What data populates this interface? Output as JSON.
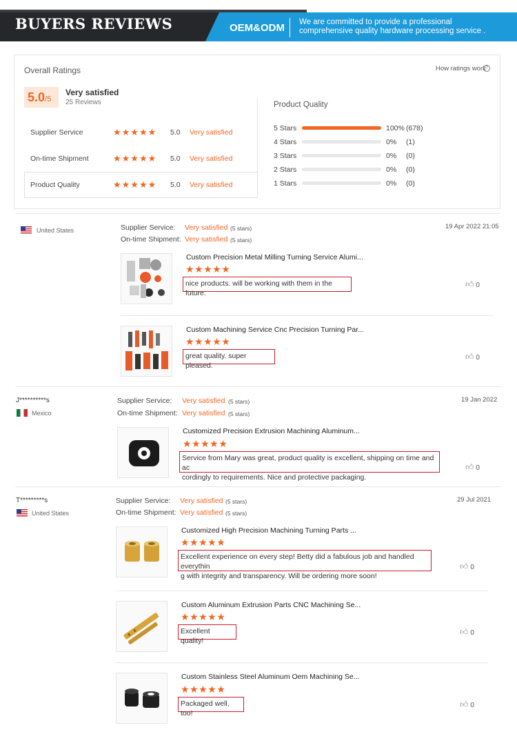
{
  "banner": {
    "title": "BUYERS REVIEWS",
    "tag": "OEM&ODM",
    "description": "We are committed to provide a professional comprehensive quality hardware processing service ."
  },
  "overall": {
    "title": "Overall Ratings",
    "how_link": "How ratings work",
    "score": "5.0",
    "score_max": "/5",
    "satisfaction": "Very satisfied",
    "review_count": "25 Reviews",
    "categories": [
      {
        "label": "Supplier Service",
        "stars": "★★★★★",
        "score": "5.0",
        "text": "Very satisfied"
      },
      {
        "label": "On-time Shipment",
        "stars": "★★★★★",
        "score": "5.0",
        "text": "Very satisfied"
      },
      {
        "label": "Product Quality",
        "stars": "★★★★★",
        "score": "5.0",
        "text": "Very satisfied"
      }
    ],
    "product_quality": {
      "title": "Product Quality",
      "rows": [
        {
          "label": "5 Stars",
          "percent": "100%",
          "count": "(678)",
          "fill": 1.0
        },
        {
          "label": "4 Stars",
          "percent": "0%",
          "count": "(1)",
          "fill": 0
        },
        {
          "label": "3 Stars",
          "percent": "0%",
          "count": "(0)",
          "fill": 0
        },
        {
          "label": "2 Stars",
          "percent": "0%",
          "count": "(0)",
          "fill": 0
        },
        {
          "label": "1 Stars",
          "percent": "0%",
          "count": "(0)",
          "fill": 0
        }
      ]
    }
  },
  "reviews": [
    {
      "name": "",
      "country": "United States",
      "supplier_label": "Supplier Service:",
      "supplier_value": "Very satisfied",
      "supplier_stars": "(5 stars)",
      "shipment_label": "On-time Shipment:",
      "shipment_value": "Very satisfied",
      "shipment_stars": "(5 stars)",
      "date": "19 Apr 2022 21:05",
      "items": [
        {
          "title": "Custom Precision Metal Milling Turning Service Alumi...",
          "stars": "★★★★★",
          "comment": "nice products. will be working with them in the future.",
          "likes": "0"
        },
        {
          "title": "Custom Machining Service Cnc Precision Turning Par...",
          "stars": "★★★★★",
          "comment": "great quality. super pleased.",
          "likes": "0"
        }
      ]
    },
    {
      "name": "J**********s",
      "country": "Mexico",
      "supplier_label": "Supplier Service:",
      "supplier_value": "Very satisfied",
      "supplier_stars": "(5 stars)",
      "shipment_label": "On-time Shipment:",
      "shipment_value": "Very satisfied",
      "shipment_stars": "(5 stars)",
      "date": "19 Jan 2022",
      "items": [
        {
          "title": "Customized Precision Extrusion Machining Aluminum...",
          "stars": "★★★★★",
          "comment_line1": "Service from Mary was great, product quality is excellent, shipping on time and ac",
          "comment_line2": "cordingly to requirements. Nice and protective packaging.",
          "likes": "0"
        }
      ]
    },
    {
      "name": "T*********s",
      "country": "United States",
      "supplier_label": "Supplier Service:",
      "supplier_value": "Very satisfied",
      "supplier_stars": "(5 stars)",
      "shipment_label": "On-time Shipment:",
      "shipment_value": "Very satisfied",
      "shipment_stars": "(5 stars)",
      "date": "29 Jul 2021",
      "items": [
        {
          "title": "Customized High Precision Machining Turning Parts ...",
          "stars": "★★★★★",
          "comment_line1": "Excellent experience on every step! Betty did a fabulous job and handled everythin",
          "comment_line2": "g with integrity and transparency. Will be ordering more soon!",
          "likes": "0"
        },
        {
          "title": "Custom Aluminum Extrusion Parts CNC Machining Se...",
          "stars": "★★★★★",
          "comment": "Excellent quality!",
          "likes": "0"
        },
        {
          "title": "Custom Stainless Steel Aluminum Oem Machining Se...",
          "stars": "★★★★★",
          "comment": "Packaged well, too!",
          "likes": "0"
        }
      ]
    }
  ]
}
